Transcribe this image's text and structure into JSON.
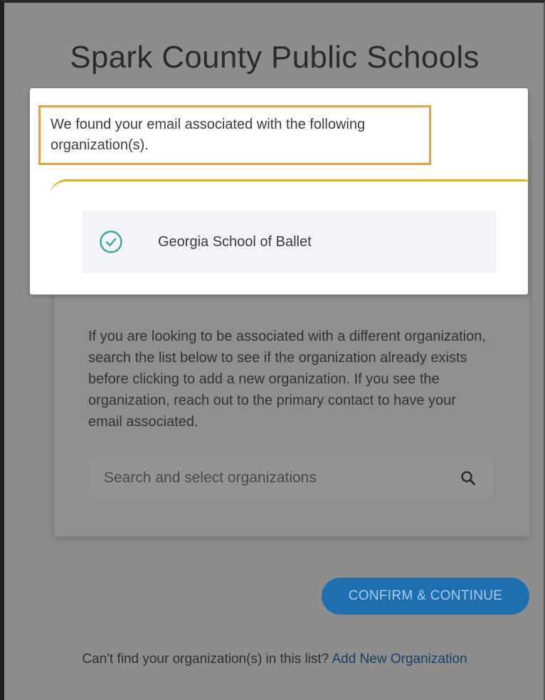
{
  "header": {
    "title": "Spark County Public Schools"
  },
  "found_panel": {
    "message": "We found your email associated with the following organization(s).",
    "organizations": [
      {
        "name": "Georgia School of Ballet",
        "selected": true,
        "icon": "check-circle-icon"
      }
    ]
  },
  "search_section": {
    "info_text": "If you are looking to be associated with a different organization, search the list below to see if the organization already exists before clicking to add a new organization. If you see the organization, reach out to the primary contact to have your email associated.",
    "search_placeholder": "Search and select organizations",
    "search_icon": "search-icon"
  },
  "actions": {
    "confirm_label": "CONFIRM & CONTINUE"
  },
  "footer": {
    "prompt": "Can't find your organization(s) in this list?",
    "link_label": "Add New Organization"
  },
  "colors": {
    "overlay_background": "#8d8d8d",
    "highlight_border": "#e6a23c",
    "accent_yellow": "#e6b21c",
    "check_teal": "#3aa89a",
    "button_blue": "#1e6fb0",
    "link_blue": "#173f69"
  }
}
